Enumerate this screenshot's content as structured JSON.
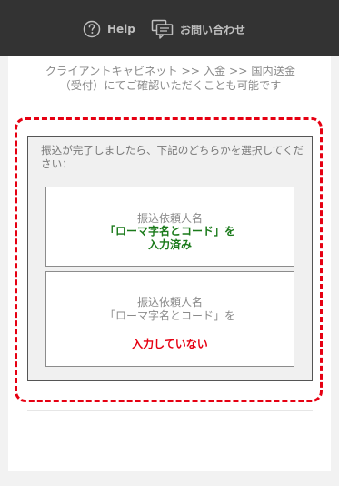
{
  "header": {
    "help_label": "Help",
    "contact_label": "お問い合わせ"
  },
  "icons": {
    "help": "question-circle-icon",
    "contact": "chat-bubble-icon"
  },
  "intro": {
    "line1": "クライアントキャビネット >> 入金 >> 国内送金",
    "line2": "（受付）にてご確認いただくことも可能です"
  },
  "instruction": {
    "text": "振込が完了しましたら、下記のどちらかを選択してください："
  },
  "option_done": {
    "line1": "振込依頼人名",
    "line2": "「ローマ字名とコード」を",
    "line3": "入力済み"
  },
  "option_not_done": {
    "line1": "振込依頼人名",
    "line2": "「ローマ字名とコード」を",
    "line3": "入力していない"
  },
  "colors": {
    "topbar": "#333333",
    "highlight_border": "#e60012",
    "done_text": "#1a7a1a",
    "not_done_text": "#e60012"
  }
}
